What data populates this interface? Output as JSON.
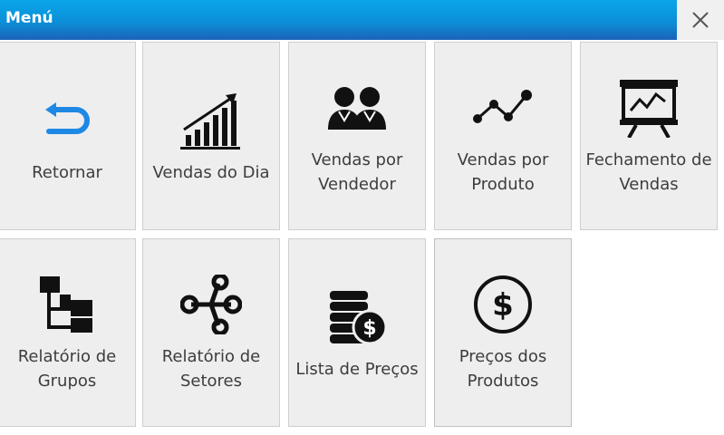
{
  "window": {
    "title": "Menú",
    "close_icon": "close-icon"
  },
  "menu": {
    "items": [
      {
        "label": "Retornar",
        "icon": "return-arrow-icon"
      },
      {
        "label": "Vendas do Dia",
        "icon": "bar-chart-icon"
      },
      {
        "label": "Vendas por\nVendedor",
        "icon": "users-icon"
      },
      {
        "label": "Vendas por\nProduto",
        "icon": "line-graph-icon"
      },
      {
        "label": "Fechamento de\nVendas",
        "icon": "presentation-chart-icon"
      },
      {
        "label": "Relatório de\nGrupos",
        "icon": "tree-hierarchy-icon"
      },
      {
        "label": "Relatório de\nSetores",
        "icon": "share-nodes-icon"
      },
      {
        "label": "Lista de Preços",
        "icon": "coins-dollar-icon"
      },
      {
        "label": "Preços dos\nProdutos",
        "icon": "dollar-circle-icon"
      }
    ]
  },
  "colors": {
    "titlebar": "#0b8fd8",
    "accent": "#1e88e5",
    "tile": "#eeeeee",
    "icon": "#111111"
  }
}
